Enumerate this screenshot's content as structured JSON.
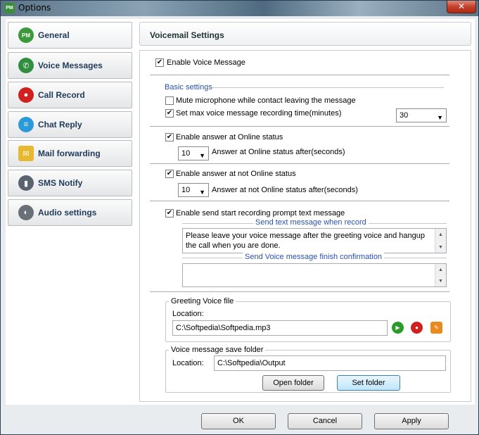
{
  "window": {
    "title": "Options",
    "close_glyph": "✕",
    "app_icon_text": "PM"
  },
  "sidebar": {
    "items": [
      {
        "label": "General",
        "icon": "pm-icon",
        "glyph": "PM",
        "color": "#3a9a3a"
      },
      {
        "label": "Voice Messages",
        "icon": "phone-icon",
        "glyph": "✆",
        "color": "#2f8f3f"
      },
      {
        "label": "Call Record",
        "icon": "record-icon",
        "glyph": "●",
        "color": "#d02020"
      },
      {
        "label": "Chat Reply",
        "icon": "chat-icon",
        "glyph": "≡",
        "color": "#2a9ad8"
      },
      {
        "label": "Mail forwarding",
        "icon": "mail-icon",
        "glyph": "✉",
        "color": "#e8b830"
      },
      {
        "label": "SMS Notify",
        "icon": "sms-icon",
        "glyph": "▮",
        "color": "#5a6470"
      },
      {
        "label": "Audio settings",
        "icon": "speaker-icon",
        "glyph": "◐",
        "color": "#6a7078"
      }
    ]
  },
  "panel": {
    "title": "Voicemail Settings",
    "enable_voice_message": {
      "label": "Enable Voice Message",
      "checked": true
    },
    "basic_settings": {
      "title": "Basic settings",
      "mute_microphone": {
        "label": "Mute microphone while contact leaving the message",
        "checked": false
      },
      "set_max_time": {
        "label": "Set max voice message recording time(minutes)",
        "checked": true,
        "value": "30"
      }
    },
    "online": {
      "label": "Enable answer at Online status",
      "checked": true,
      "value": "10",
      "after_label": "Answer at Online status after(seconds)"
    },
    "not_online": {
      "label": "Enable answer at not Online status",
      "checked": true,
      "value": "10",
      "after_label": "Answer at not Online  status  after(seconds)"
    },
    "prompt": {
      "label": "Enable send start recording prompt text message",
      "checked": true,
      "send_text_title": "Send text message when record",
      "send_text_value": "Please leave your voice message after the greeting voice and hangup the call when you are done.",
      "finish_title": "Send Voice message finish confirmation",
      "finish_value": ""
    },
    "greeting": {
      "title": "Greeting Voice file",
      "location_label": "Location:",
      "location_value": "C:\\Softpedia\\Softpedia.mp3"
    },
    "save_folder": {
      "title": "Voice message save folder",
      "location_label": "Location:",
      "location_value": "C:\\Softpedia\\Output",
      "open_folder": "Open folder",
      "set_folder": "Set folder"
    }
  },
  "footer": {
    "ok": "OK",
    "cancel": "Cancel",
    "apply": "Apply"
  },
  "glyphs": {
    "check": "✔",
    "dropdown": "▼",
    "scroll_up": "▲",
    "scroll_down": "▼",
    "play": "▶",
    "record": "●",
    "browse": "✎"
  },
  "colors": {
    "accent_blue": "#2a50b0",
    "play_green": "#2a9a2a",
    "record_red": "#d02020",
    "browse_orange": "#e88a20"
  }
}
